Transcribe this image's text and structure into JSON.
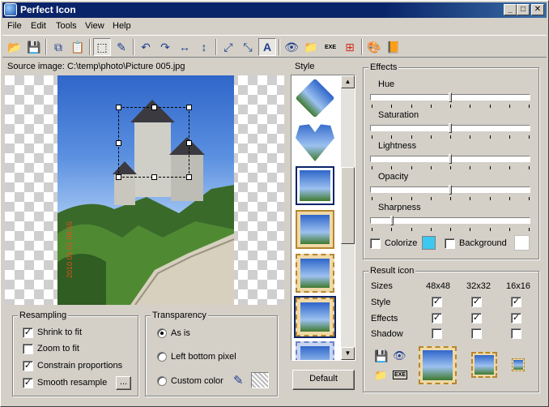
{
  "app": {
    "title": "Perfect Icon",
    "window_buttons": [
      "_",
      "□",
      "✕"
    ]
  },
  "menu": [
    {
      "label": "File"
    },
    {
      "label": "Edit"
    },
    {
      "label": "Tools"
    },
    {
      "label": "View"
    },
    {
      "label": "Help"
    }
  ],
  "toolbar": {
    "tools": [
      "open-icon",
      "save-icon",
      "copy-icon",
      "paste-icon",
      "select-rect-icon",
      "eyedropper-icon",
      "rotate-left-icon",
      "rotate-right-icon",
      "flip-horizontal-icon",
      "flip-vertical-icon",
      "zoom-in-icon",
      "zoom-out-icon",
      "auto-fit-icon",
      "preview-icon",
      "new-folder-icon",
      "exe-icon",
      "windows-icon",
      "palette-icon",
      "book-icon"
    ],
    "glyphs": [
      "📂",
      "💾",
      "⧉",
      "📋",
      "⬚",
      "✎",
      "↶",
      "↷",
      "↔",
      "↕",
      "⤢",
      "⤡",
      "A",
      "👁",
      "📁",
      "EXE",
      "⊞",
      "🎨",
      "📙"
    ]
  },
  "source": {
    "label": "Source image: C:\\temp\\photo\\Picture 005.jpg",
    "watermark": "2010 06 01 08:55"
  },
  "style_panel": {
    "title": "Style",
    "default_button": "Default"
  },
  "resampling": {
    "title": "Resampling",
    "options": [
      {
        "label": "Shrink to fit",
        "checked": true
      },
      {
        "label": "Zoom to fit",
        "checked": false
      },
      {
        "label": "Constrain proportions",
        "checked": true
      },
      {
        "label": "Smooth resample",
        "checked": true
      }
    ],
    "more_button": "..."
  },
  "transparency": {
    "title": "Transparency",
    "options": [
      {
        "label": "As is",
        "selected": true
      },
      {
        "label": "Left bottom pixel",
        "selected": false
      },
      {
        "label": "Custom color",
        "selected": false
      }
    ]
  },
  "effects": {
    "title": "Effects",
    "sliders": [
      {
        "label": "Hue",
        "value": 0.5
      },
      {
        "label": "Saturation",
        "value": 0.5
      },
      {
        "label": "Lightness",
        "value": 0.5
      },
      {
        "label": "Opacity",
        "value": 0.5
      },
      {
        "label": "Sharpness",
        "value": 0.13
      }
    ],
    "colorize_label": "Colorize",
    "colorize_checked": false,
    "colorize_color": "#3cc8ef",
    "background_label": "Background",
    "background_checked": false,
    "background_color": "#ffffff"
  },
  "result": {
    "title": "Result icon",
    "headers": [
      "Sizes",
      "48x48",
      "32x32",
      "16x16"
    ],
    "rows": [
      {
        "label": "Style",
        "values": [
          true,
          true,
          true
        ]
      },
      {
        "label": "Effects",
        "values": [
          true,
          true,
          true
        ]
      },
      {
        "label": "Shadow",
        "values": [
          false,
          false,
          false
        ]
      }
    ]
  }
}
